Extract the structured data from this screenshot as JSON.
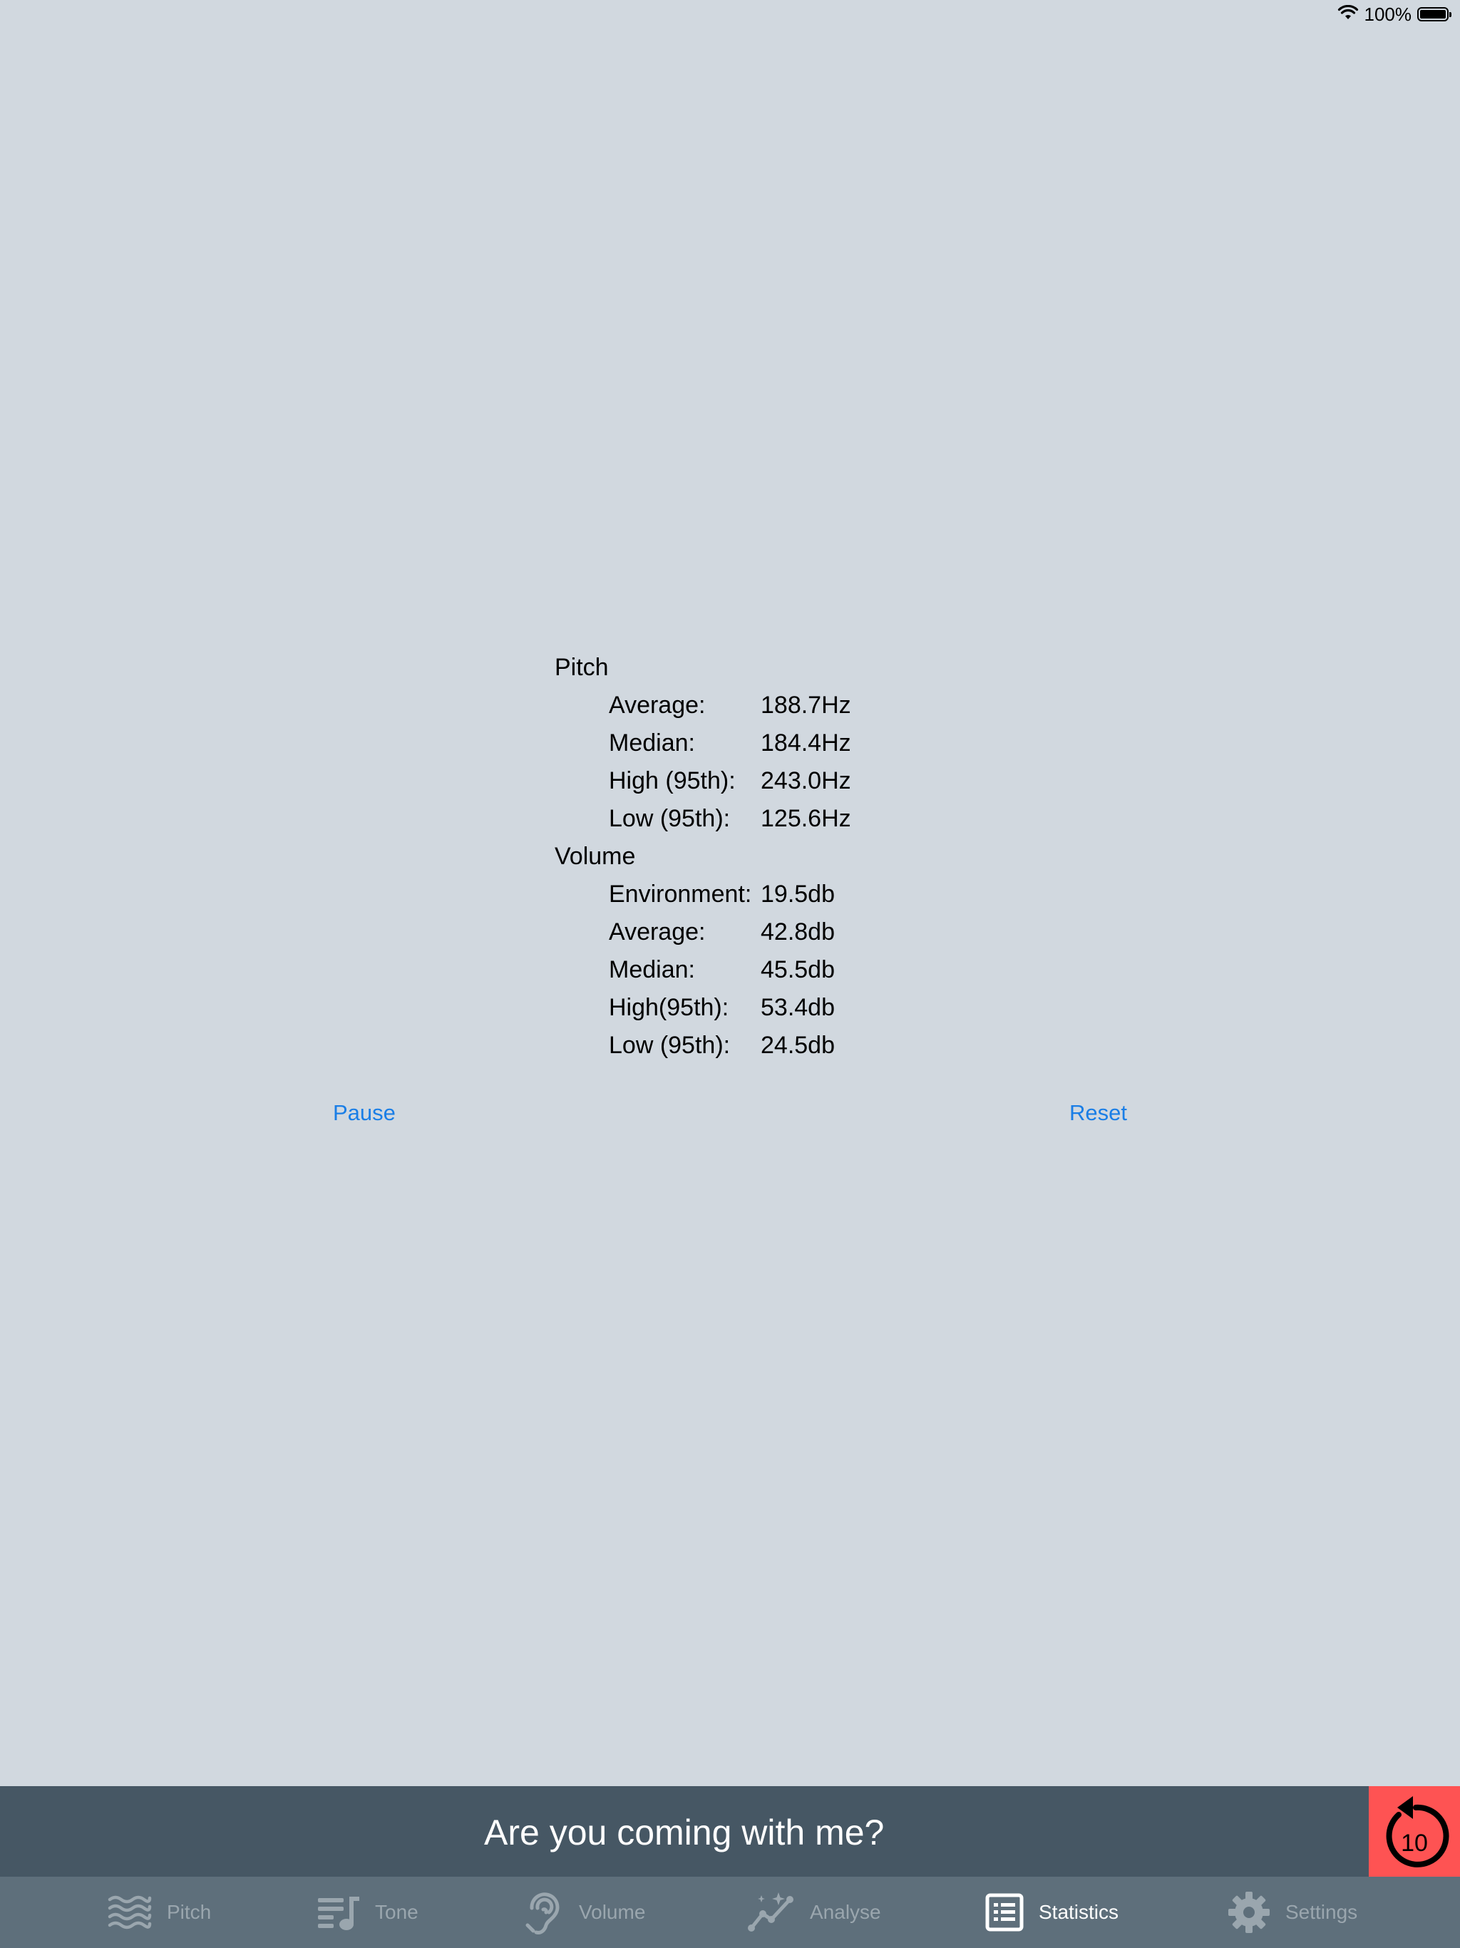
{
  "status_bar": {
    "battery_percent": "100%",
    "battery_level": 1.0
  },
  "pitch": {
    "title": "Pitch",
    "rows": [
      {
        "label": "Average:",
        "value": "188.7Hz"
      },
      {
        "label": "Median:",
        "value": "184.4Hz"
      },
      {
        "label": "High (95th):",
        "value": "243.0Hz"
      },
      {
        "label": "Low (95th):",
        "value": "125.6Hz"
      }
    ]
  },
  "volume": {
    "title": "Volume",
    "rows": [
      {
        "label": "Environment:",
        "value": "19.5db"
      },
      {
        "label": "Average:",
        "value": "42.8db"
      },
      {
        "label": "Median:",
        "value": "45.5db"
      },
      {
        "label": "High(95th):",
        "value": "53.4db"
      },
      {
        "label": "Low (95th):",
        "value": "24.5db"
      }
    ]
  },
  "actions": {
    "pause_label": "Pause",
    "reset_label": "Reset"
  },
  "banner": {
    "text": "Are you coming with me?",
    "replay_seconds": "10",
    "replay_icon": "replay-10-icon"
  },
  "tabs": [
    {
      "label": "Pitch",
      "icon": "waves-icon",
      "active": false
    },
    {
      "label": "Tone",
      "icon": "music-list-icon",
      "active": false
    },
    {
      "label": "Volume",
      "icon": "ear-icon",
      "active": false
    },
    {
      "label": "Analyse",
      "icon": "chart-sparkle-icon",
      "active": false
    },
    {
      "label": "Statistics",
      "icon": "list-icon",
      "active": true
    },
    {
      "label": "Settings",
      "icon": "gear-icon",
      "active": false
    }
  ],
  "colors": {
    "background": "#d1d8df",
    "link": "#1a7ee6",
    "banner": "#465764",
    "replay": "#fe5353",
    "tab_bar": "#5e6f7b",
    "tab_inactive": "#9aa6ae",
    "tab_active": "#ffffff"
  }
}
